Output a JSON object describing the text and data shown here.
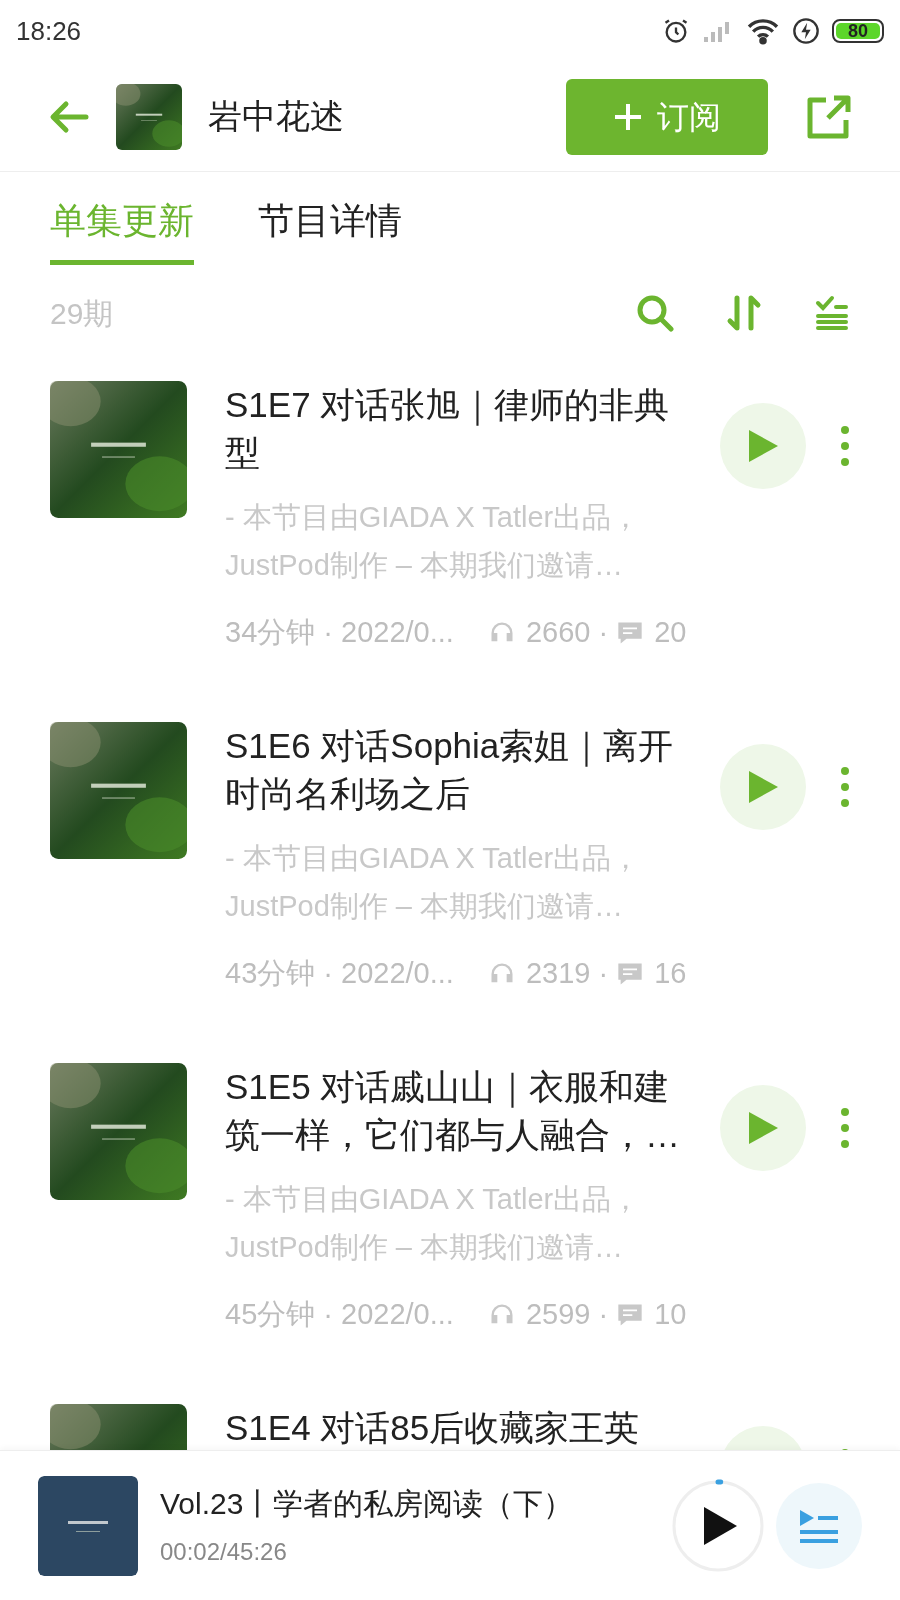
{
  "status_bar": {
    "time": "18:26",
    "battery": "80"
  },
  "header": {
    "title": "岩中花述",
    "subscribe": "订阅"
  },
  "tabs": [
    {
      "label": "单集更新",
      "selected": true
    },
    {
      "label": "节目详情",
      "selected": false
    }
  ],
  "count": "29期",
  "episodes": [
    {
      "title": "S1E7 对话张旭｜律师的非典型",
      "description": "- 本节目由GIADA X Tatler出品，JustPod制作 – 本期我们邀请…",
      "meta": "34分钟 · 2022/0...",
      "plays": "2660 ·",
      "comments": "20"
    },
    {
      "title": "S1E6 对话Sophia索姐｜离开时尚名利场之后",
      "description": "- 本节目由GIADA X Tatler出品，JustPod制作 – 本期我们邀请…",
      "meta": "43分钟 · 2022/0...",
      "plays": "2319 ·",
      "comments": "16"
    },
    {
      "title": "S1E5 对话戚山山｜衣服和建筑一样，它们都与人融合，…",
      "description": "- 本节目由GIADA X Tatler出品，JustPod制作 – 本期我们邀请…",
      "meta": "45分钟 · 2022/0...",
      "plays": "2599 ·",
      "comments": "10"
    },
    {
      "title": "S1E4 对话85后收藏家王英"
    }
  ],
  "player": {
    "title": "Vol.23丨学者的私房阅读（下）",
    "time": "00:02/45:26",
    "level": 0.01
  }
}
